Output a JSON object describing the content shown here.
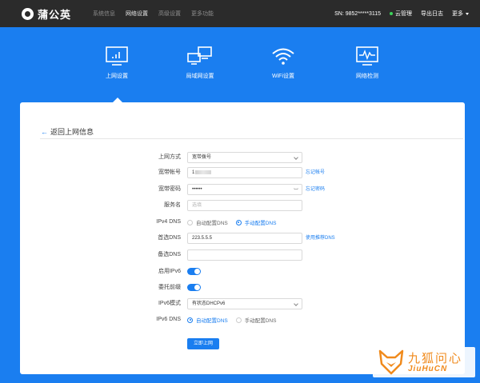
{
  "app": {
    "logo_text": "蒲公英"
  },
  "topnav": {
    "items": [
      "系统信息",
      "网络设置",
      "高级设置",
      "更多功能"
    ],
    "active_index": 1
  },
  "topright": {
    "sn_label": "SN: 9852*****3115",
    "cloud_label": "云管理",
    "export_label": "导出日志",
    "more_label": "更多"
  },
  "hero": {
    "items": [
      {
        "label": "上网设置",
        "icon": "monitor-chart-icon"
      },
      {
        "label": "局域网设置",
        "icon": "lan-computers-icon"
      },
      {
        "label": "WiFi设置",
        "icon": "wifi-icon"
      },
      {
        "label": "网络检测",
        "icon": "monitor-pulse-icon"
      }
    ],
    "active_index": 0
  },
  "card": {
    "back_label": "返回上网信息",
    "form": {
      "connection_type": {
        "label": "上网方式",
        "value": "宽带拨号"
      },
      "account": {
        "label": "宽带帐号",
        "value": "1",
        "link": "忘记帐号"
      },
      "password": {
        "label": "宽带密码",
        "value": "••••••",
        "link": "忘记密码"
      },
      "service_name": {
        "label": "服务名",
        "placeholder": "选填"
      },
      "ipv4_dns": {
        "label": "IPv4 DNS",
        "options": [
          "自动配置DNS",
          "手动配置DNS"
        ],
        "selected_index": 1
      },
      "primary_dns": {
        "label": "首选DNS",
        "value": "223.5.5.5",
        "link": "使用推荐DNS"
      },
      "secondary_dns": {
        "label": "备选DNS",
        "value": ""
      },
      "enable_ipv6": {
        "label": "启用IPv6",
        "on": true
      },
      "delegate_prefix": {
        "label": "委托前缀",
        "on": true
      },
      "ipv6_mode": {
        "label": "IPv6模式",
        "value": "有状态DHCPv6"
      },
      "ipv6_dns": {
        "label": "IPv6 DNS",
        "options": [
          "自动配置DNS",
          "手动配置DNS"
        ],
        "selected_index": 0
      },
      "submit_label": "立即上网"
    }
  },
  "watermark": {
    "cn_text": "九狐问心",
    "en_text": "JiuHuCN"
  },
  "colors": {
    "accent": "#1a7ef0",
    "topbar": "#2b2b2b",
    "watermark": "#f08a1c"
  }
}
